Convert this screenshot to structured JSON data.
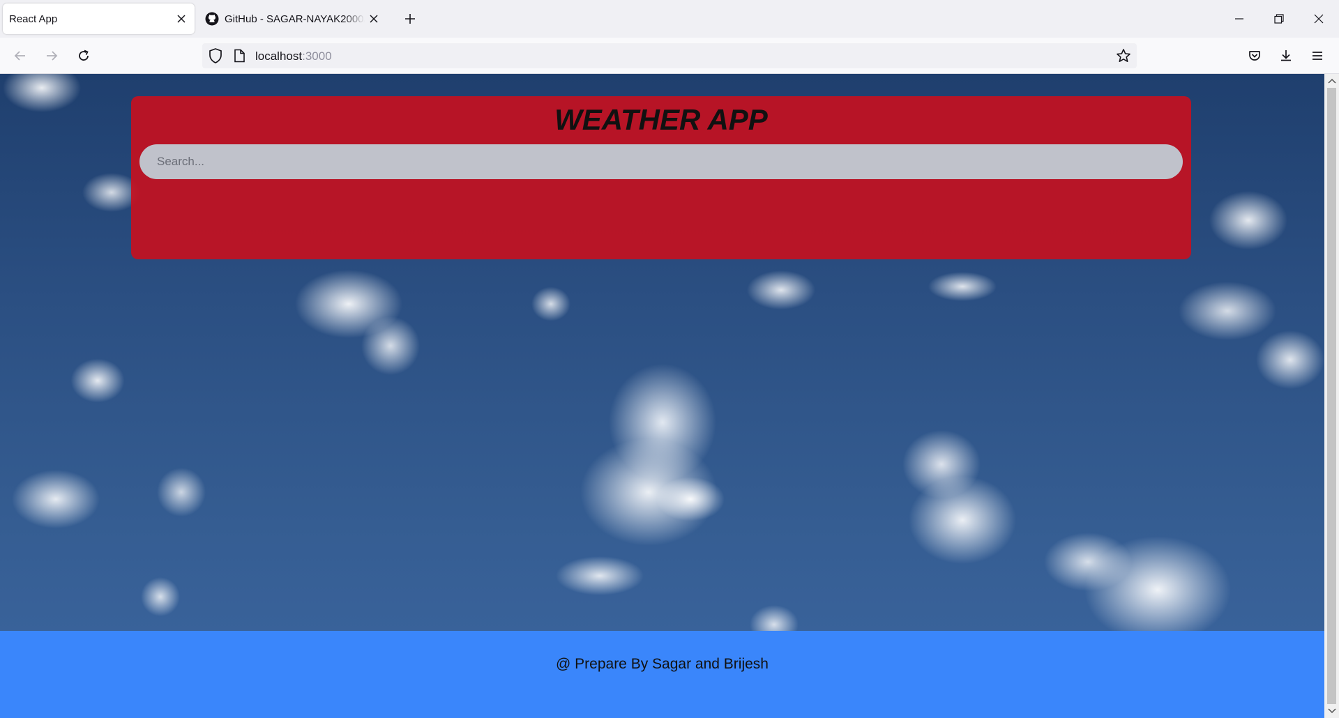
{
  "browser": {
    "tabs": [
      {
        "title": "React App",
        "active": true
      },
      {
        "title": "GitHub - SAGAR-NAYAK2000/w",
        "active": false
      }
    ],
    "url_host": "localhost",
    "url_port": ":3000"
  },
  "app": {
    "title": "WEATHER APP",
    "search_placeholder": "Search..."
  },
  "footer": {
    "text": "@ Prepare By Sagar and Brijesh"
  },
  "colors": {
    "card": "#c80f1e",
    "search_bg": "#c0c2cb",
    "footer_bg": "#3a86fb"
  }
}
